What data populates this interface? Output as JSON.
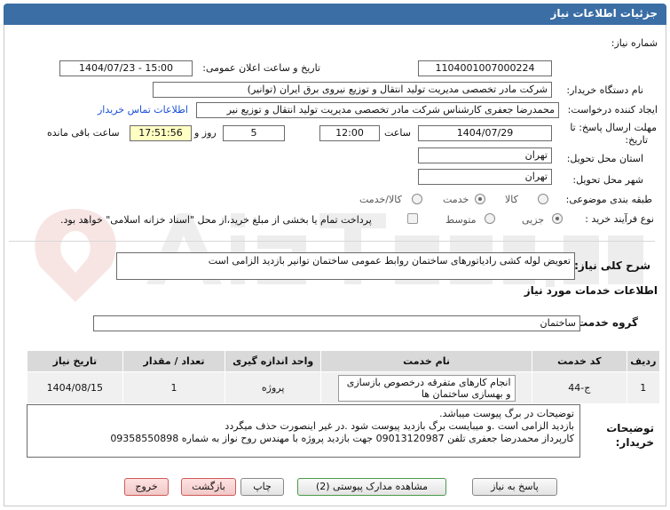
{
  "header": {
    "title": "جزئیات اطلاعات نیاز"
  },
  "need": {
    "number_label": "شماره نیاز:",
    "number_value": "1104001007000224",
    "announce_label": "تاریخ و ساعت اعلان عمومی:",
    "announce_value": "1404/07/23 - 15:00",
    "buyer_label": "نام دستگاه خریدار:",
    "buyer_value": "شرکت مادر تخصصی مدیریت تولید  انتقال و توزیع نیروی برق ایران (توانیر)",
    "creator_label": "ایجاد کننده درخواست:",
    "creator_value": "محمدرضا جعفری کارشناس شرکت مادر تخصصی مدیریت تولید  انتقال و توزیع نیر",
    "contact_link": "اطلاعات تماس خریدار",
    "deadline_label_1": "مهلت ارسال پاسخ: تا",
    "deadline_label_2": "تاریخ:",
    "deadline_date": "1404/07/29",
    "hour_label": "ساعت",
    "deadline_time": "12:00",
    "days_value": "5",
    "days_label": "روز و",
    "remaining_time": "17:51:56",
    "remaining_label": "ساعت باقی مانده",
    "province_label": "استان محل تحویل:",
    "province_value": "تهران",
    "city_label": "شهر محل تحویل:",
    "city_value": "تهران",
    "category_label": "طبقه بندی موضوعی:",
    "category_options": [
      "کالا",
      "خدمت",
      "کالا/خدمت"
    ],
    "category_selected": 1,
    "process_label": "نوع فرآیند خرید :",
    "process_options": [
      "جزیی",
      "متوسط"
    ],
    "process_selected": 0,
    "payment_note": "پرداخت تمام یا بخشی از مبلغ خرید،از محل \"اسناد خزانه اسلامی\" خواهد بود."
  },
  "summary": {
    "label": "شرح کلی نیاز:",
    "value": "تعویض لوله کشی رادیاتورهای ساختمان روابط عمومی ساختمان توانیر بازدید الزامی است"
  },
  "services": {
    "section_title": "اطلاعات خدمات مورد نیاز",
    "group_label": "گروه خدمت:",
    "group_value": "ساختمان",
    "columns": [
      "ردیف",
      "کد خدمت",
      "نام خدمت",
      "واحد اندازه گیری",
      "تعداد / مقدار",
      "تاریخ نیاز"
    ],
    "rows": [
      {
        "row": "1",
        "code": "ج-44",
        "name": "انجام کارهای متفرقه درخصوص بازسازی و بهسازی ساختمان ها",
        "unit": "پروژه",
        "qty": "1",
        "date": "1404/08/15"
      }
    ]
  },
  "buyer_notes": {
    "label_1": "توضیحات",
    "label_2": "خریدار:",
    "lines": [
      "توضیحات در برگ پیوست میباشد.",
      "بازدید الزامی است .و میبایست برگ بازدید پیوست شود .در غیر اینصورت  حذف میگردد",
      "کارپرداز محمدرضا جعفری  تلفن 09013120987 جهت بازدید پروژه با مهندس روح نواز به شماره 09358550898"
    ]
  },
  "buttons": {
    "reply": "پاسخ به نیاز",
    "attachments": "مشاهده مدارک پیوستی (2)",
    "print": "چاپ",
    "back": "بازگشت",
    "exit": "خروج"
  },
  "colors": {
    "header": "#3a6ea5",
    "yellow_field": "#ffffc4",
    "link": "#1a4fd6"
  }
}
